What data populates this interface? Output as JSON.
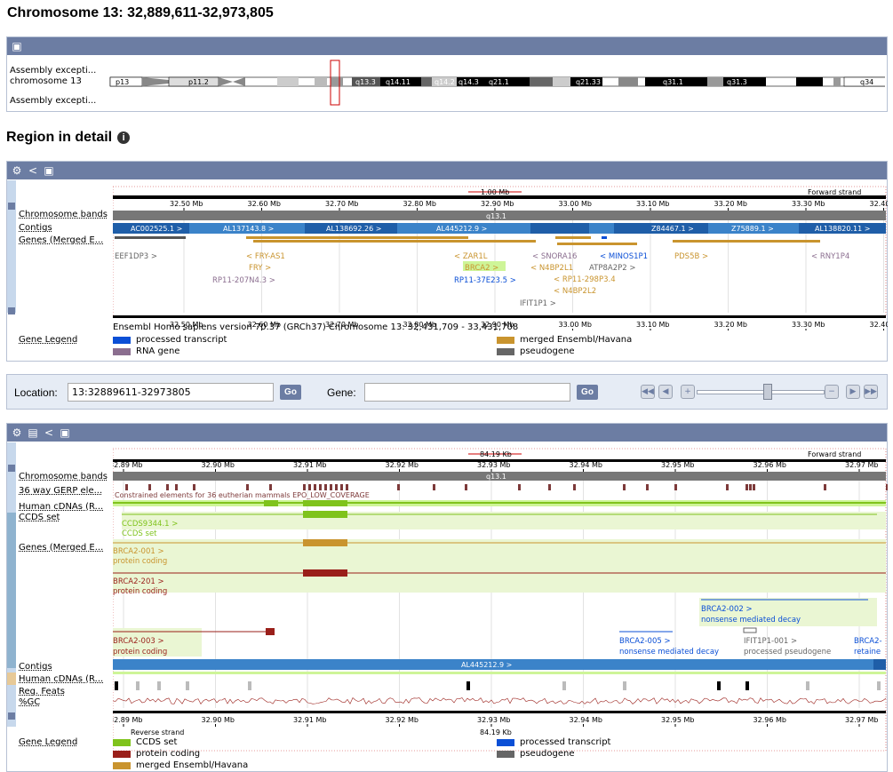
{
  "page_title": "Chromosome 13: 32,889,611-32,973,805",
  "section_title": "Region in detail",
  "ideogram": {
    "labels": [
      "Assembly excepti...",
      "chromosome 13",
      "Assembly excepti..."
    ],
    "bands": [
      "p13",
      "p11.2",
      "q13.3",
      "q14.11",
      "q14.2",
      "q14.3",
      "q21.1",
      "q21.33",
      "q31.1",
      "q31.3",
      "q34"
    ]
  },
  "overview": {
    "scale_length": "1.00 Mb",
    "strand": "Forward strand",
    "ticks": [
      "32.50 Mb",
      "32.60 Mb",
      "32.70 Mb",
      "32.80 Mb",
      "32.90 Mb",
      "33.00 Mb",
      "33.10 Mb",
      "33.20 Mb",
      "33.30 Mb",
      "32.40"
    ],
    "band_name": "q13.1",
    "contigs": [
      "AC002525.1 >",
      "AL137143.8 >",
      "AL138692.26 >",
      "AL445212.9 >",
      "Z84467.1 >",
      "Z75889.1 >",
      "AL138820.11 >"
    ],
    "genes": [
      "EEF1DP3 >",
      "< FRY-AS1",
      "FRY >",
      "RP11-207N4.3 >",
      "< ZAR1L",
      "BRCA2 >",
      "RP11-37E23.5 >",
      "< SNORA16",
      "< MINOS1P1",
      "< N4BP2L1",
      "ATP8A2P2 >",
      "< RP11-298P3.4",
      "< N4BP2L2",
      "IFIT1P1 >",
      "PDS5B >",
      "< RNY1P4"
    ],
    "track_labels": [
      "Chromosome bands",
      "Contigs",
      "Genes (Merged E..."
    ],
    "assembly_note": "Ensembl Homo sapiens version 70.37 (GRCh37) Chromosome 13: 32,431,709 - 33,431,708",
    "legend_title": "Gene Legend",
    "legend": [
      {
        "label": "processed transcript",
        "color": "#0b4fd6"
      },
      {
        "label": "merged Ensembl/Havana",
        "color": "#c9942e"
      },
      {
        "label": "RNA gene",
        "color": "#8b6e8f"
      },
      {
        "label": "pseudogene",
        "color": "#666666"
      }
    ]
  },
  "navigation": {
    "location_label": "Location:",
    "location_value": "13:32889611-32973805",
    "go_label": "Go",
    "gene_label": "Gene:",
    "gene_value": ""
  },
  "detail": {
    "scale_length": "84.19 Kb",
    "strand_fwd": "Forward strand",
    "strand_rev": "Reverse strand",
    "ticks": [
      "32.89 Mb",
      "32.90 Mb",
      "32.91 Mb",
      "32.92 Mb",
      "32.93 Mb",
      "32.94 Mb",
      "32.95 Mb",
      "32.96 Mb",
      "32.97 Mb"
    ],
    "band_name": "q13.1",
    "track_labels": [
      "Chromosome bands",
      "36 way GERP ele...",
      "Human cDNAs (R...",
      "CCDS set",
      "Genes (Merged E...",
      "Contigs",
      "Human cDNAs (R...",
      "Reg. Feats",
      "%GC"
    ],
    "constrained_label": "Constrained elements for 36 eutherian mammals EPO_LOW_COVERAGE",
    "transcripts": [
      {
        "name": "CCDS9344.1 >",
        "type": "CCDS set"
      },
      {
        "name": "BRCA2-001 >",
        "type": "protein coding"
      },
      {
        "name": "BRCA2-201 >",
        "type": "protein coding"
      },
      {
        "name": "BRCA2-002 >",
        "type": "nonsense mediated decay"
      },
      {
        "name": "BRCA2-003 >",
        "type": "protein coding"
      },
      {
        "name": "BRCA2-005 >",
        "type": "nonsense mediated decay"
      },
      {
        "name": "IFIT1P1-001 >",
        "type": "processed pseudogene"
      },
      {
        "name": "BRCA2-",
        "type": "retaine"
      }
    ],
    "contig": "AL445212.9 >",
    "legend_title": "Gene Legend",
    "legend": [
      {
        "label": "CCDS set",
        "color": "#7fc31c"
      },
      {
        "label": "processed transcript",
        "color": "#0b4fd6"
      },
      {
        "label": "protein coding",
        "color": "#9a1f1a"
      },
      {
        "label": "pseudogene",
        "color": "#666666"
      },
      {
        "label": "merged Ensembl/Havana",
        "color": "#c9942e"
      }
    ]
  }
}
